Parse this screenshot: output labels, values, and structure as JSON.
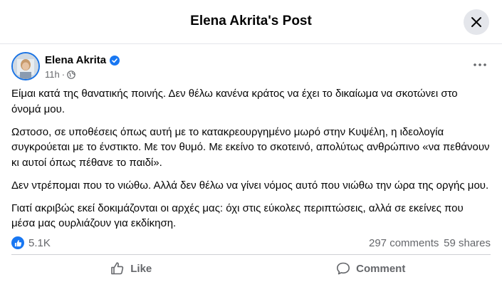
{
  "header": {
    "title": "Elena Akrita's Post"
  },
  "post": {
    "author": "Elena Akrita",
    "time": "11h",
    "separator": "·",
    "paragraphs": [
      "Είμαι κατά της θανατικής ποινής. Δεν θέλω κανένα κράτος να έχει το δικαίωμα να σκοτώνει στο όνομά μου.",
      "Ωστοσο, σε υποθέσεις όπως αυτή με το κατακρεουργημένο μωρό στην Κυψέλη, η ιδεολογία συγκρούεται με το ένστικτο. Με τον θυμό. Με εκείνο το σκοτεινό, απολύτως ανθρώπινο «να πεθάνουν κι αυτοί όπως πέθανε το παιδί».",
      "Δεν ντρέπομαι που το νιώθω. Αλλά δεν θέλω να γίνει νόμος αυτό που νιώθω την ώρα της οργής μου.",
      "Γιατί ακριβώς εκεί δοκιμάζονται οι αρχές μας: όχι στις εύκολες περιπτώσεις, αλλά σε εκείνες που μέσα μας ουρλιάζουν για εκδίκηση."
    ]
  },
  "stats": {
    "reactions": "5.1K",
    "comments": "297 comments",
    "shares": "59 shares"
  },
  "actions": {
    "like": "Like",
    "comment": "Comment"
  },
  "icons": {
    "close": "close-icon",
    "verified": "verified-badge-icon",
    "privacy": "globe-icon",
    "more": "more-options-icon",
    "like_reaction": "thumbs-up-icon",
    "like_action": "like-icon",
    "comment_action": "comment-icon"
  },
  "colors": {
    "accent": "#1877f2",
    "secondary_text": "#65676b",
    "primary_text": "#050505"
  }
}
